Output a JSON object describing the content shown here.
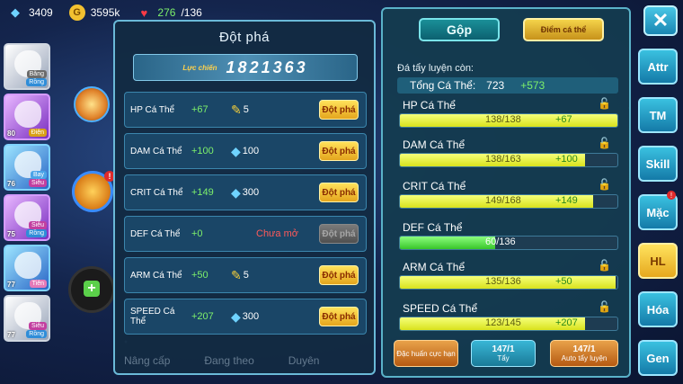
{
  "resources": {
    "gems": "3409",
    "coins": "3595k",
    "energy_current": "276",
    "energy_max": "/136"
  },
  "roster": [
    {
      "tag1": "Băng",
      "tag2": "Rồng",
      "level": ""
    },
    {
      "tag1": "Điện",
      "tag2": "",
      "level": "80"
    },
    {
      "tag1": "Bay",
      "tag2": "Siêu",
      "level": "76"
    },
    {
      "tag1": "Siêu",
      "tag2": "Rồng",
      "level": "75"
    },
    {
      "tag1": "Tiên",
      "tag2": "",
      "level": "77"
    },
    {
      "tag1": "Siêu",
      "tag2": "Rồng",
      "level": "77"
    }
  ],
  "left_panel": {
    "title": "Đột phá",
    "power_label": "Lực chiến",
    "power_value": "1821363",
    "rows": [
      {
        "name": "HP Cá Thể",
        "bonus": "+67",
        "cost_icon": "scroll-icon",
        "cost": "5",
        "action": "Đột phá",
        "locked_text": ""
      },
      {
        "name": "DAM Cá Thể",
        "bonus": "+100",
        "cost_icon": "diamond-icon",
        "cost": "100",
        "action": "Đột phá",
        "locked_text": ""
      },
      {
        "name": "CRIT Cá Thể",
        "bonus": "+149",
        "cost_icon": "diamond-icon",
        "cost": "300",
        "action": "Đột phá",
        "locked_text": ""
      },
      {
        "name": "DEF Cá Thể",
        "bonus": "+0",
        "cost_icon": "",
        "cost": "",
        "action": "Đột phá",
        "locked_text": "Chưa mở"
      },
      {
        "name": "ARM Cá Thể",
        "bonus": "+50",
        "cost_icon": "scroll-icon",
        "cost": "5",
        "action": "Đột phá",
        "locked_text": ""
      },
      {
        "name": "SPEED Cá Thể",
        "bonus": "+207",
        "cost_icon": "diamond-icon",
        "cost": "300",
        "action": "Đột phá",
        "locked_text": ""
      }
    ],
    "bottom_tabs": [
      "Nâng cấp",
      "Đang theo",
      "Duyên"
    ]
  },
  "right_panel": {
    "tab_merge": "Gộp",
    "tab_individual": "Điểm cá thể",
    "remaining_label": "Đá tẩy luyện còn:",
    "total_label": "Tổng Cá Thể:",
    "total_value": "723",
    "total_bonus": "+573",
    "stats": [
      {
        "name": "HP Cá Thể",
        "value": "138/138",
        "bonus": "+67",
        "fill": 1.0,
        "locked": true
      },
      {
        "name": "DAM Cá Thể",
        "value": "138/163",
        "bonus": "+100",
        "fill": 0.85,
        "locked": true
      },
      {
        "name": "CRIT Cá Thể",
        "value": "149/168",
        "bonus": "+149",
        "fill": 0.89,
        "locked": true
      },
      {
        "name": "DEF Cá Thể",
        "value": "60/136",
        "bonus": "",
        "fill": 0.44,
        "locked": false
      },
      {
        "name": "ARM Cá Thể",
        "value": "135/136",
        "bonus": "+50",
        "fill": 0.99,
        "locked": true
      },
      {
        "name": "SPEED Cá Thể",
        "value": "123/145",
        "bonus": "+207",
        "fill": 0.85,
        "locked": true
      }
    ],
    "btn_special": "Đặc huấn cực hạn",
    "btn_wash_count": "147/1",
    "btn_wash_label": "Tẩy",
    "btn_auto_count": "147/1",
    "btn_auto_label": "Auto tẩy luyện"
  },
  "side_nav": [
    "Attr",
    "TM",
    "Skill",
    "Mặc",
    "HL",
    "Hóa",
    "Gen"
  ],
  "side_badge": "!"
}
